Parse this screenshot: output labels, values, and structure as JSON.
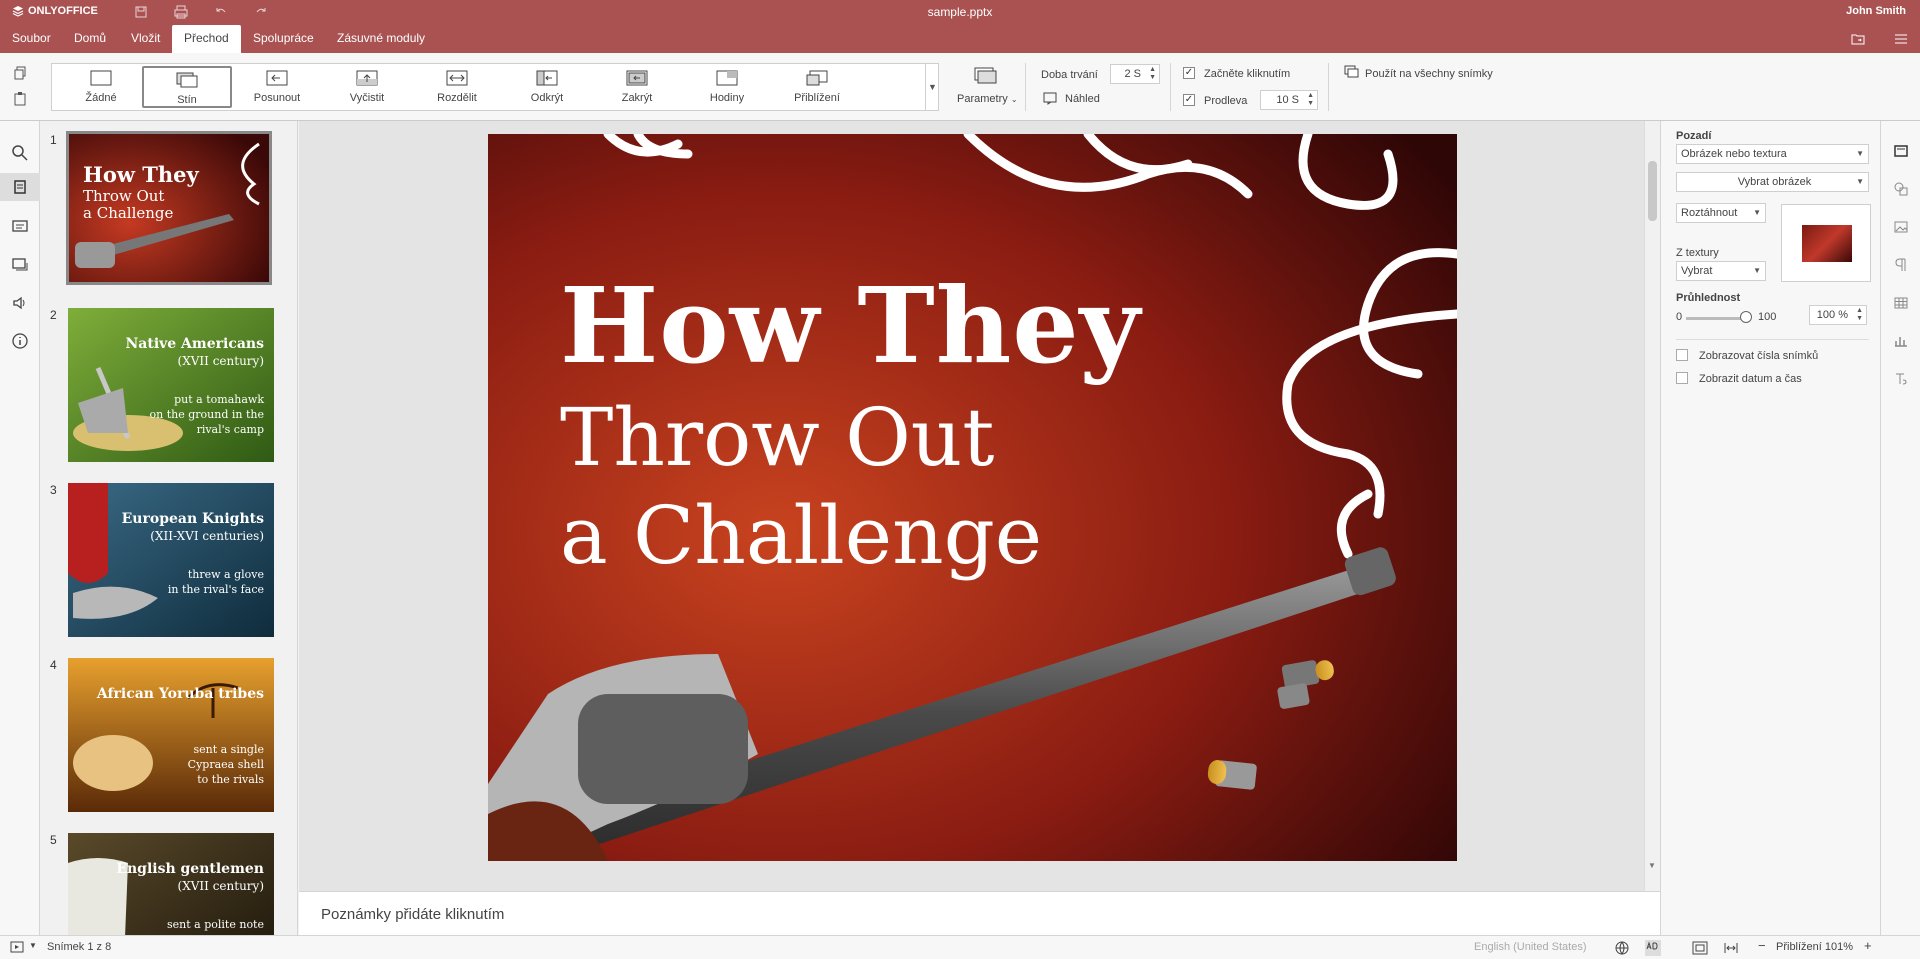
{
  "app": {
    "logo": "ONLYOFFICE",
    "doc_title": "sample.pptx",
    "user": "John Smith",
    "accent": "#aa5252"
  },
  "menu": {
    "tabs": [
      "Soubor",
      "Domů",
      "Vložit",
      "Přechod",
      "Spolupráce",
      "Zásuvné moduly"
    ],
    "active": "Přechod"
  },
  "toolbar": {
    "transitions": [
      "Žádné",
      "Stín",
      "Posunout",
      "Vyčistit",
      "Rozdělit",
      "Odkrýt",
      "Zakrýt",
      "Hodiny",
      "Přiblížení"
    ],
    "selected_transition": "Stín",
    "parameters": "Parametry",
    "duration_label": "Doba trvání",
    "duration_value": "2 S",
    "preview_label": "Náhled",
    "start_on_click": "Začněte kliknutím",
    "delay_label": "Prodleva",
    "delay_value": "10 S",
    "apply_all": "Použít na všechny snímky"
  },
  "slides": [
    {
      "num": "1",
      "title": "How They",
      "sub": "Throw Out\na Challenge",
      "body": ""
    },
    {
      "num": "2",
      "title": "Native Americans",
      "sub": "(XVII century)",
      "body": "put a tomahawk\non the ground in the\nrival's camp"
    },
    {
      "num": "3",
      "title": "European Knights",
      "sub": "(XII-XVI centuries)",
      "body": "threw a glove\nin the rival's face"
    },
    {
      "num": "4",
      "title": "African Yoruba tribes",
      "sub": "",
      "body": "sent a single\nCypraea shell\nto the rivals"
    },
    {
      "num": "5",
      "title": "English gentlemen",
      "sub": "(XVII century)",
      "body": "sent a polite note"
    }
  ],
  "main_slide": {
    "title": "How They",
    "subtitle": "Throw Out\na Challenge"
  },
  "notes_placeholder": "Poznámky přidáte kliknutím",
  "right_panel": {
    "background_label": "Pozadí",
    "fill_type": "Obrázek nebo textura",
    "select_picture": "Vybrat obrázek",
    "stretch": "Roztáhnout",
    "from_texture_label": "Z textury",
    "texture_select": "Vybrat",
    "opacity_label": "Průhlednost",
    "opacity_min": "0",
    "opacity_max": "100",
    "opacity_value": "100 %",
    "show_slide_numbers": "Zobrazovat čísla snímků",
    "show_date_time": "Zobrazit datum a čas"
  },
  "status": {
    "slide_counter": "Snímek 1 z 8",
    "language": "English (United States)",
    "zoom": "Přiblížení 101%"
  }
}
